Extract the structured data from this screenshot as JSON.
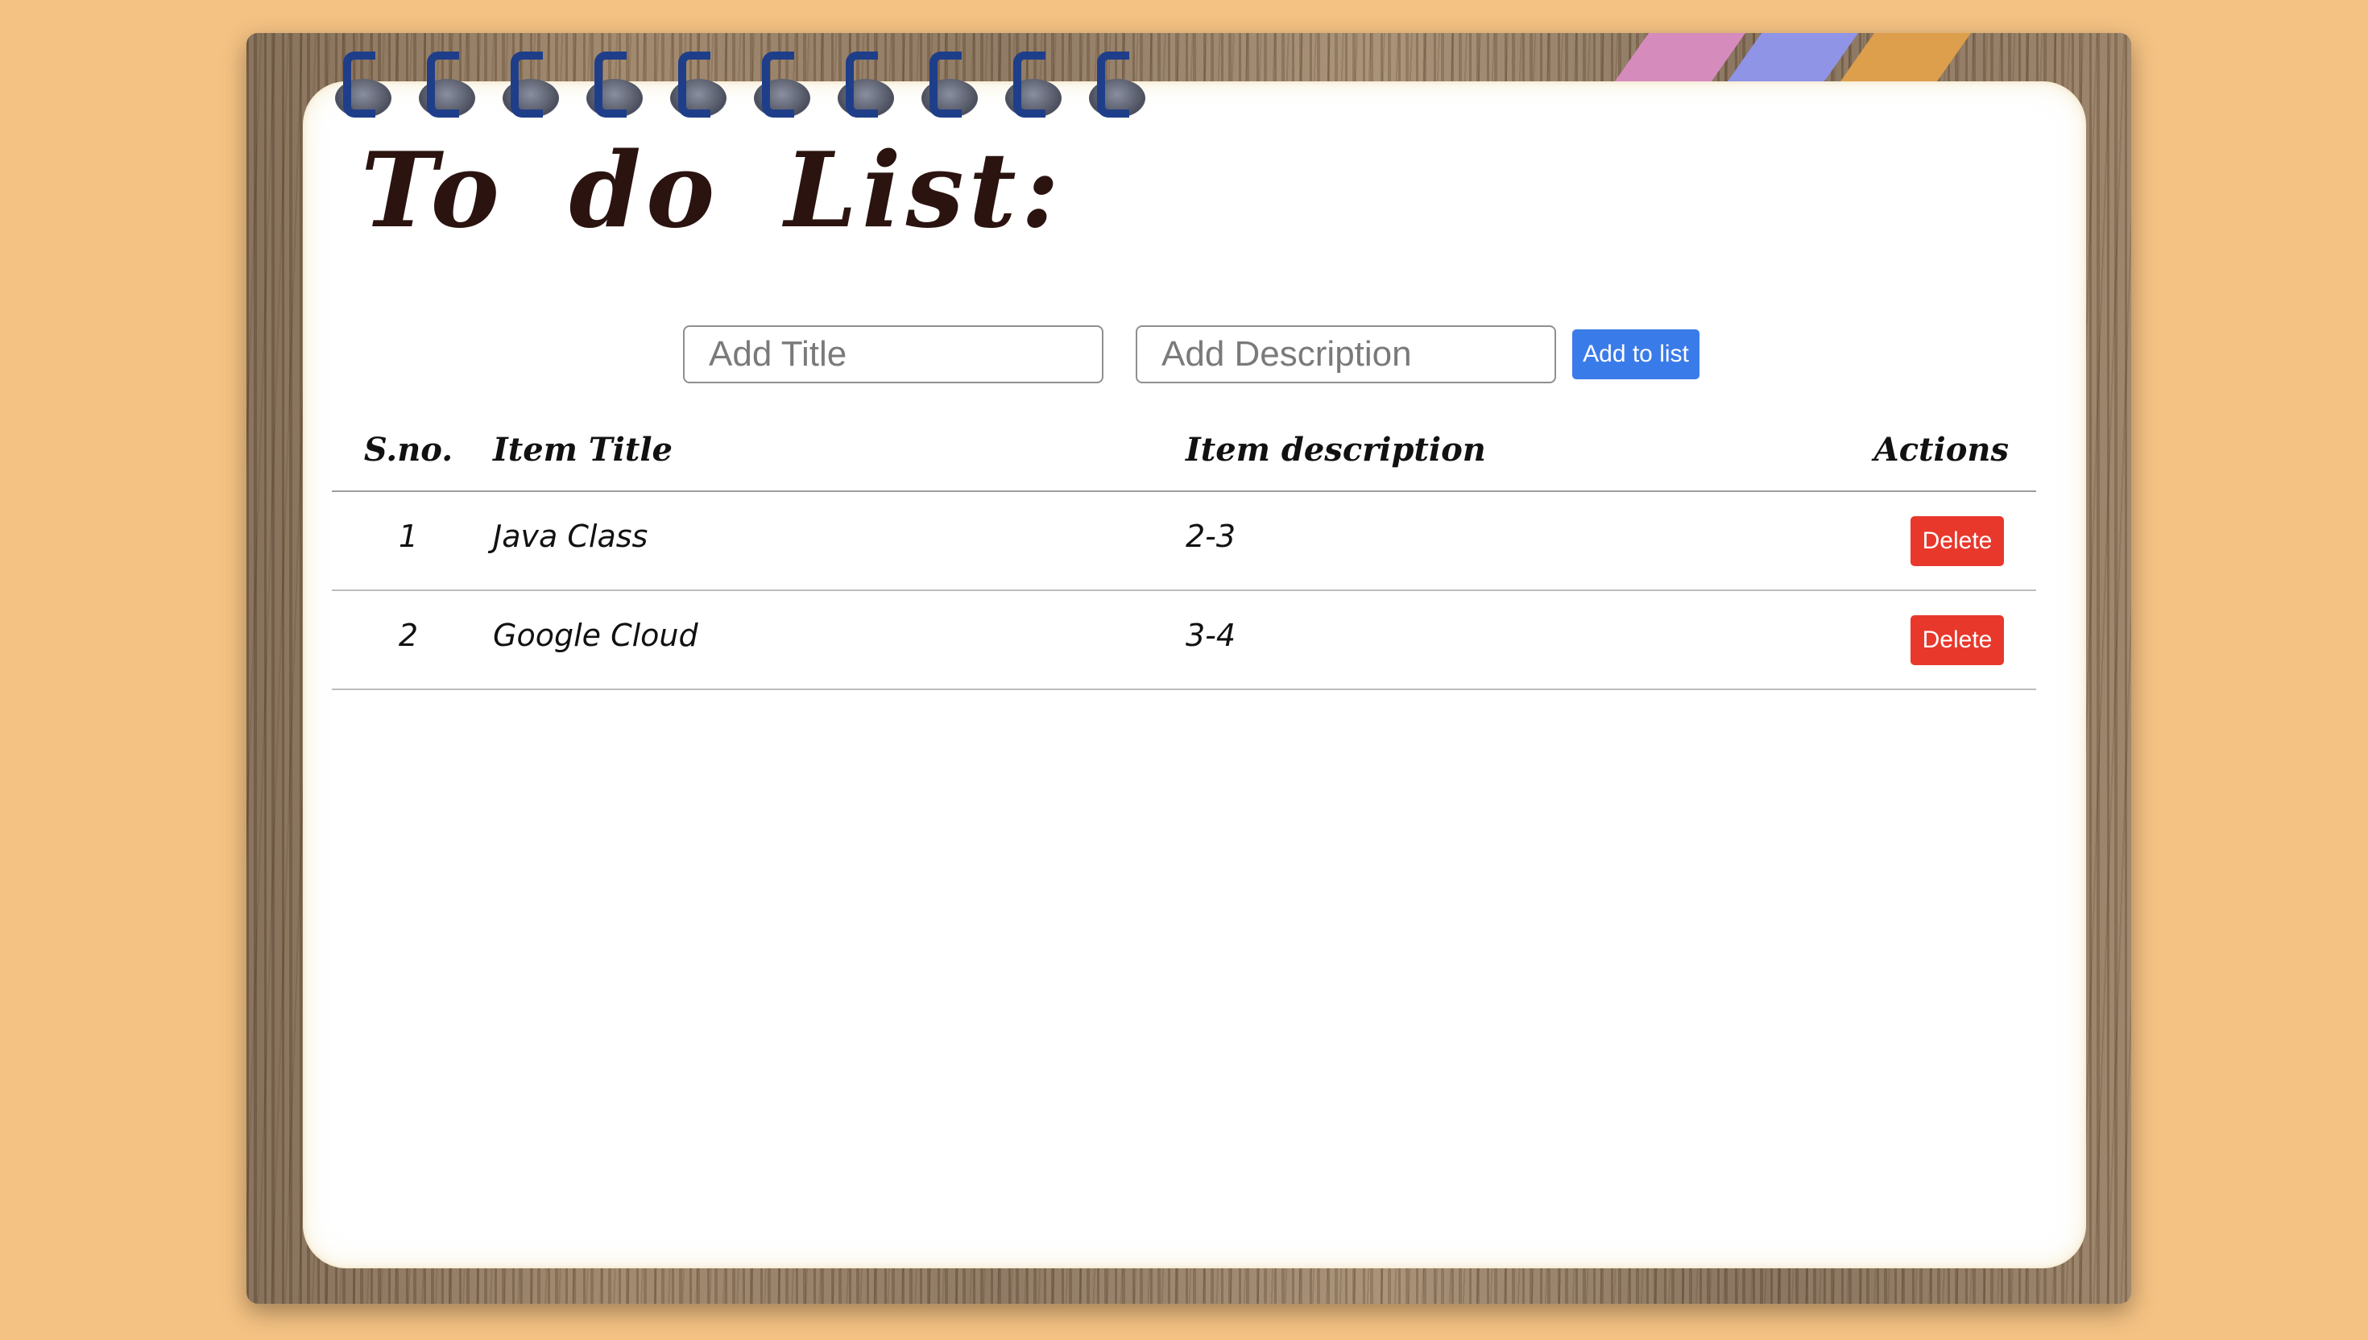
{
  "header": {
    "title": "To do List:"
  },
  "form": {
    "title_placeholder": "Add Title",
    "title_value": "",
    "description_placeholder": "Add Description",
    "description_value": "",
    "add_button_label": "Add to list"
  },
  "table": {
    "columns": [
      "S.no.",
      "Item Title",
      "Item description",
      "Actions"
    ],
    "rows": [
      {
        "sno": "1",
        "title": "Java Class",
        "description": "2-3",
        "action_label": "Delete"
      },
      {
        "sno": "2",
        "title": "Google Cloud",
        "description": "3-4",
        "action_label": "Delete"
      }
    ]
  },
  "colors": {
    "background": "#f4c283",
    "accent_button": "#3a7bea",
    "delete_button": "#e8382c",
    "ring": "#1f3e8a",
    "stripes": [
      "#d68bbd",
      "#8f94e6",
      "#dd9f4c"
    ]
  },
  "icons": {
    "binder_rings": "spiral-ring-icon"
  }
}
